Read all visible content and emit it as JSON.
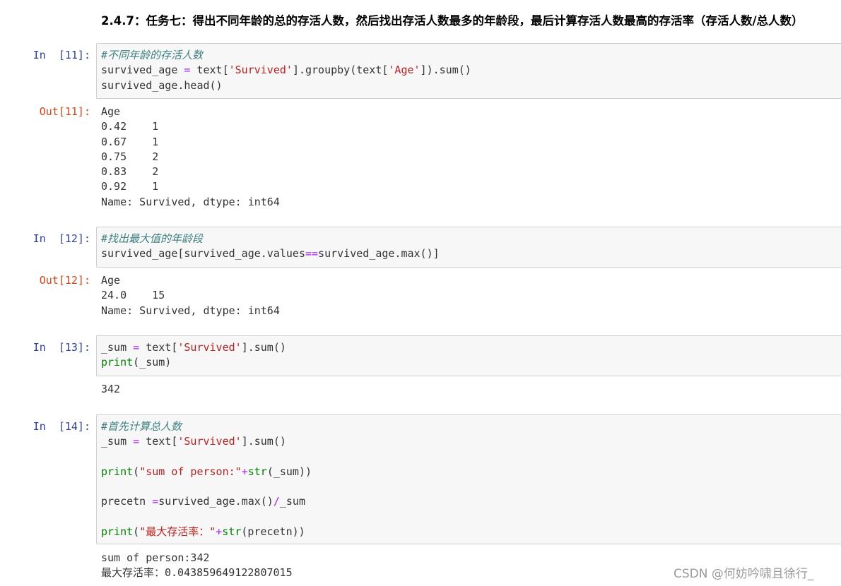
{
  "heading": "2.4.7：任务七：得出不同年龄的总的存活人数，然后找出存活人数最多的年龄段，最后计算存活人数最高的存活率（存活人数/总人数）",
  "cells": [
    {
      "in_prompt": "In  [11]:",
      "out_prompt": "Out[11]:",
      "code": [
        "#不同年龄的存活人数",
        "survived_age = text['Survived'].groupby(text['Age']).sum()",
        "survived_age.head()"
      ],
      "output": [
        "Age",
        "0.42    1",
        "0.67    1",
        "0.75    2",
        "0.83    2",
        "0.92    1",
        "Name: Survived, dtype: int64"
      ]
    },
    {
      "in_prompt": "In  [12]:",
      "out_prompt": "Out[12]:",
      "code": [
        "#找出最大值的年龄段",
        "survived_age[survived_age.values==survived_age.max()]"
      ],
      "output": [
        "Age",
        "24.0    15",
        "Name: Survived, dtype: int64"
      ]
    },
    {
      "in_prompt": "In  [13]:",
      "out_prompt": "",
      "code": [
        "_sum = text['Survived'].sum()",
        "print(_sum)"
      ],
      "output": [
        "342"
      ]
    },
    {
      "in_prompt": "In  [14]:",
      "out_prompt": "",
      "code": [
        "#首先计算总人数",
        "_sum = text['Survived'].sum()",
        "",
        "print(\"sum of person:\"+str(_sum))",
        "",
        "precetn =survived_age.max()/_sum",
        "",
        "print(\"最大存活率：\"+str(precetn))"
      ],
      "output": [
        "sum of person:342",
        "最大存活率：0.043859649122807015"
      ]
    }
  ],
  "watermark": "CSDN @何妨吟啸且徐行_"
}
